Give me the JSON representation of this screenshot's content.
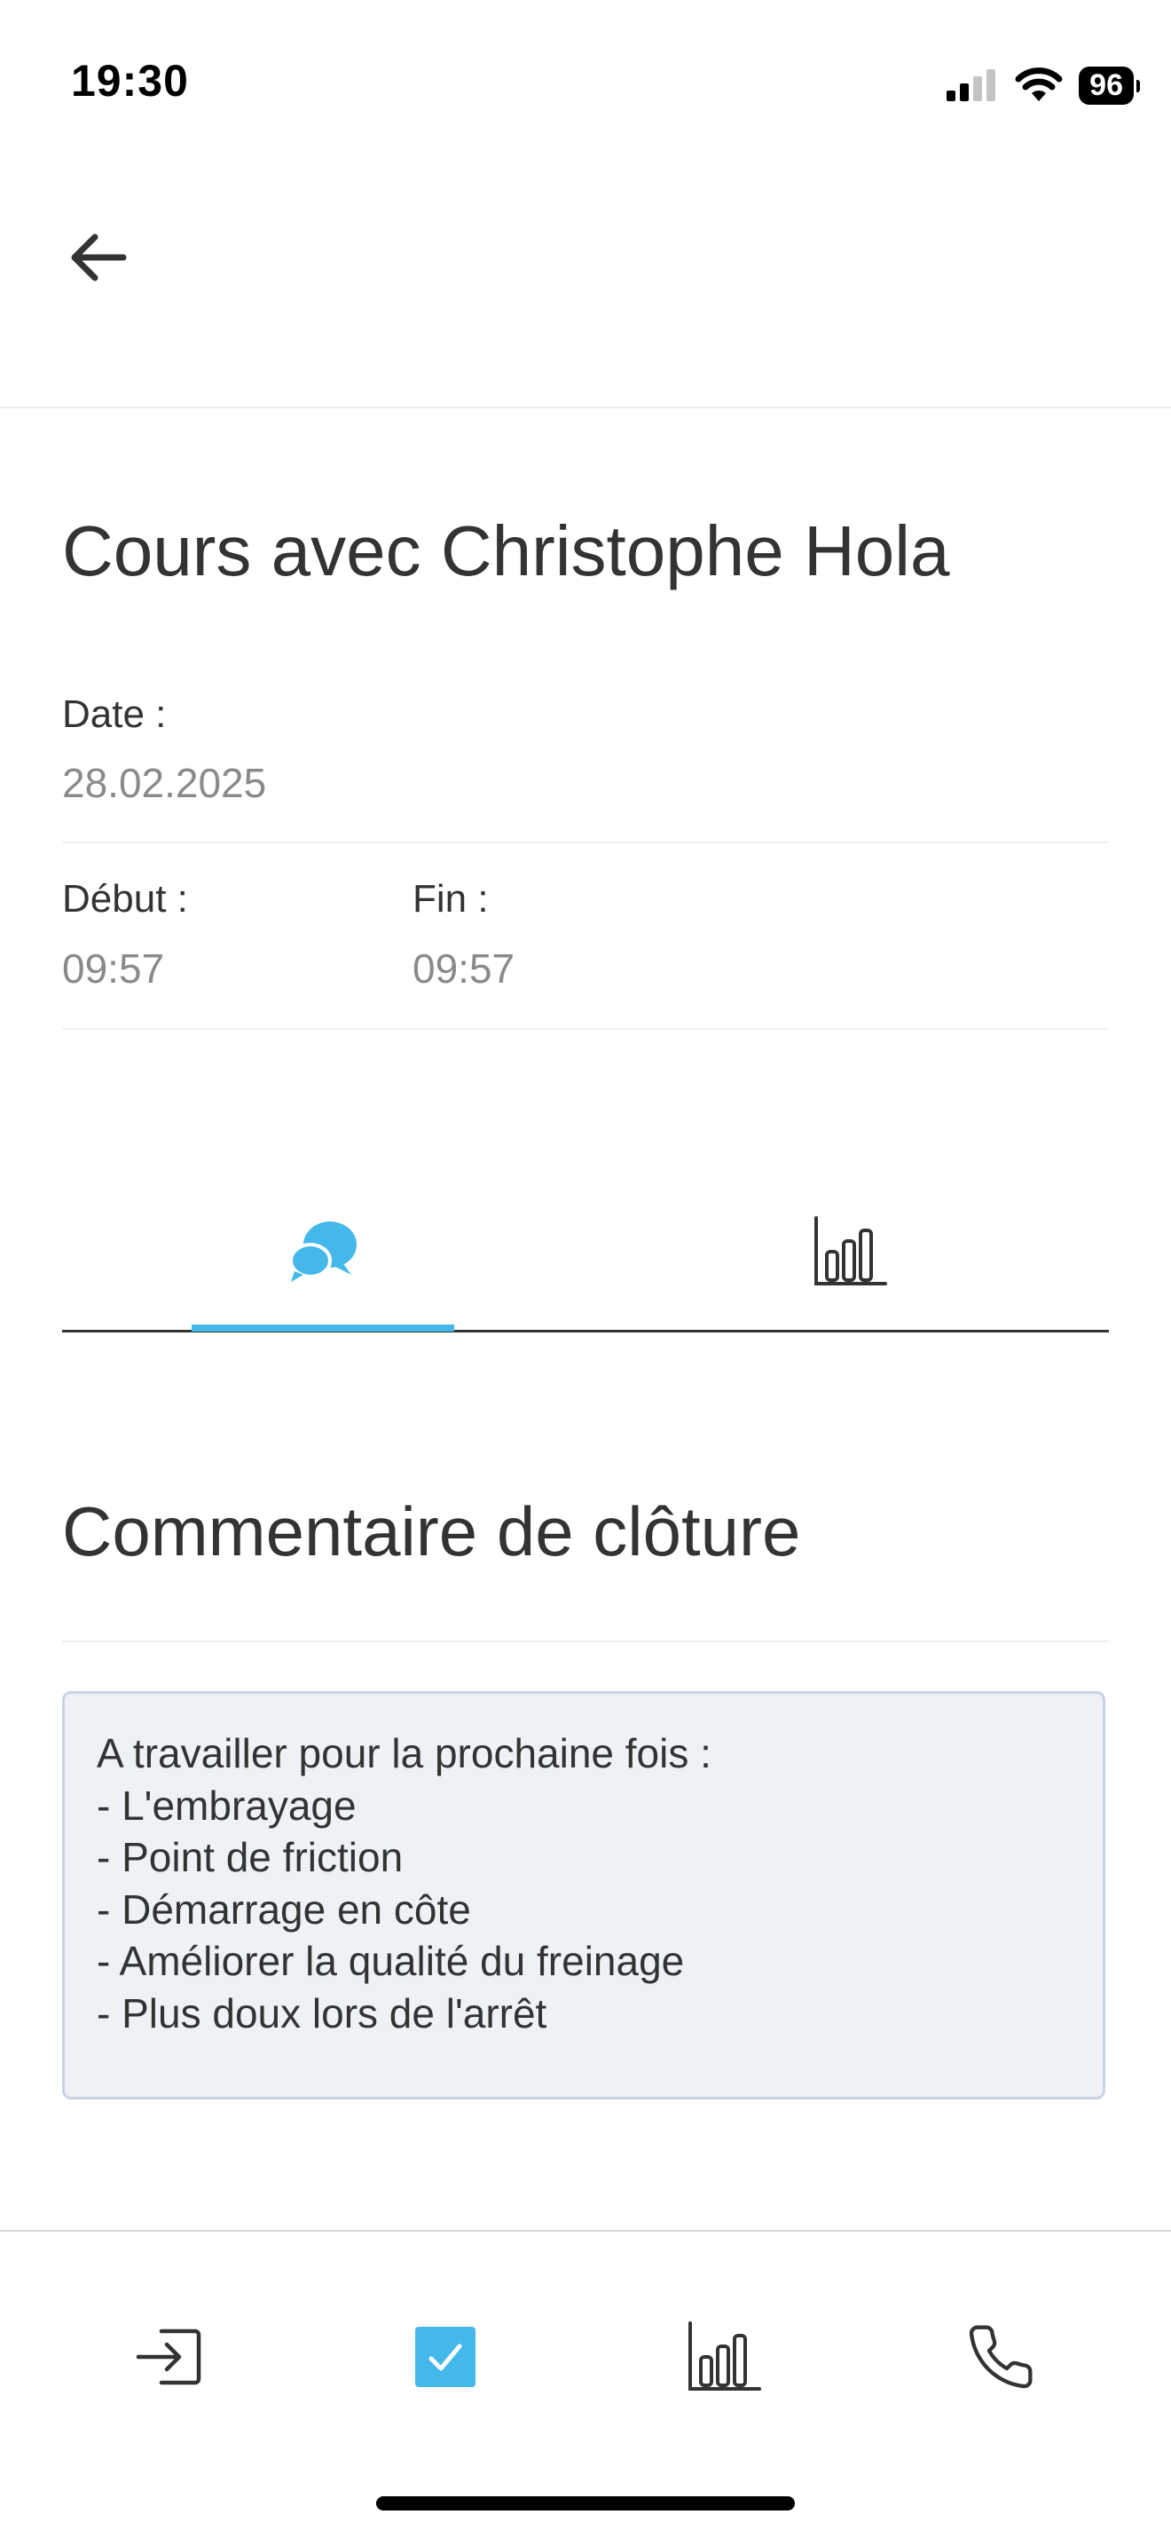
{
  "status_bar": {
    "time": "19:30",
    "battery": "96",
    "icons": [
      "cellular-signal-icon",
      "wifi-icon",
      "battery-icon"
    ]
  },
  "header": {
    "back_icon": "arrow-left-icon"
  },
  "lesson": {
    "title": "Cours avec Christophe Hola",
    "date_label": "Date :",
    "date_value": "28.02.2025",
    "start_label": "Début :",
    "start_value": "09:57",
    "end_label": "Fin :",
    "end_value": "09:57"
  },
  "tabs": [
    {
      "icon": "chat-bubbles-icon",
      "active": true
    },
    {
      "icon": "bar-chart-icon",
      "active": false
    }
  ],
  "closing_comment": {
    "title": "Commentaire de clôture",
    "lines": [
      "A travailler pour la prochaine fois :",
      "- L'embrayage",
      "- Point de friction",
      "- Démarrage en côte",
      "- Améliorer la qualité du freinage",
      "- Plus doux lors de l'arrêt"
    ]
  },
  "bottom_nav": [
    {
      "icon": "login-icon",
      "active": false
    },
    {
      "icon": "checkbox-icon",
      "active": true
    },
    {
      "icon": "bar-chart-icon",
      "active": false
    },
    {
      "icon": "phone-icon",
      "active": false
    }
  ],
  "colors": {
    "accent": "#45b8ea",
    "text": "#333333",
    "muted": "#8a8a8a",
    "comment_bg": "#eef2f7",
    "comment_border": "#c9d4e2"
  }
}
